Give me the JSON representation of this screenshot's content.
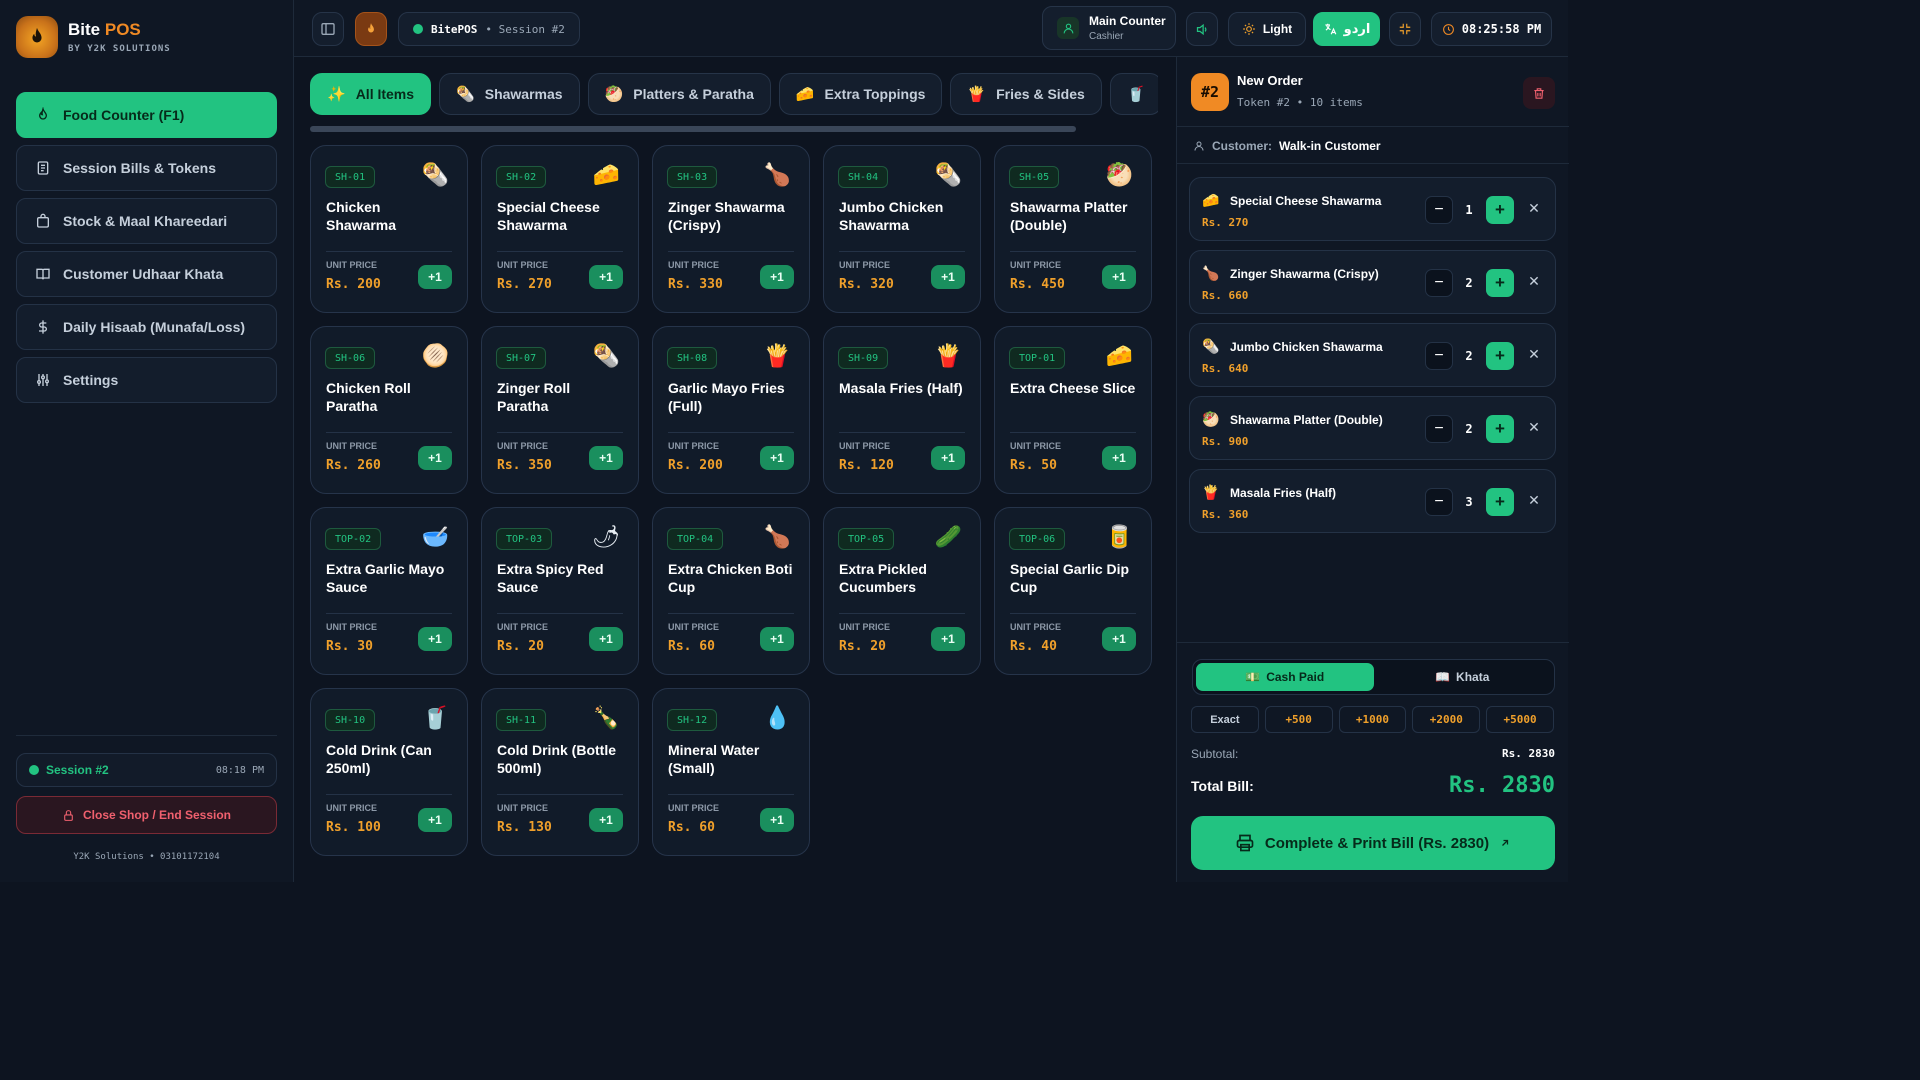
{
  "brand": {
    "name": "Bite",
    "name_accent": "POS",
    "sub": "BY Y2K SOLUTIONS"
  },
  "nav": [
    {
      "label": "Food Counter (F1)",
      "icon": "flame-icon",
      "active": true
    },
    {
      "label": "Session Bills & Tokens",
      "icon": "receipt-icon"
    },
    {
      "label": "Stock & Maal Khareedari",
      "icon": "bag-icon"
    },
    {
      "label": "Customer Udhaar Khata",
      "icon": "book-icon"
    },
    {
      "label": "Daily Hisaab (Munafa/Loss)",
      "icon": "dollar-icon"
    },
    {
      "label": "Settings",
      "icon": "sliders-icon"
    }
  ],
  "sidebar_footer": {
    "session_label": "Session #2",
    "session_time": "08:18 PM",
    "close_label": "Close Shop / End Session",
    "credit": "Y2K Solutions • 03101172104"
  },
  "topbar": {
    "app": "BitePOS",
    "session": "• Session #2",
    "counter_title": "Main Counter",
    "counter_role": "Cashier",
    "theme_label": "Light",
    "language_label": "اردو",
    "clock": "08:25:58 PM"
  },
  "categories": [
    {
      "label": "All Items",
      "icon": "✨",
      "active": true
    },
    {
      "label": "Shawarmas",
      "icon": "🌯"
    },
    {
      "label": "Platters & Paratha",
      "icon": "🥙"
    },
    {
      "label": "Extra Toppings",
      "icon": "🧀"
    },
    {
      "label": "Fries & Sides",
      "icon": "🍟"
    },
    {
      "label": "",
      "icon": "🥤"
    }
  ],
  "card_labels": {
    "unit_price": "UNIT PRICE",
    "add": "+1"
  },
  "products": [
    {
      "code": "SH-01",
      "name": "Chicken Shawarma",
      "price": "Rs. 200",
      "emoji": "🌯"
    },
    {
      "code": "SH-02",
      "name": "Special Cheese Shawarma",
      "price": "Rs. 270",
      "emoji": "🧀"
    },
    {
      "code": "SH-03",
      "name": "Zinger Shawarma (Crispy)",
      "price": "Rs. 330",
      "emoji": "🍗"
    },
    {
      "code": "SH-04",
      "name": "Jumbo Chicken Shawarma",
      "price": "Rs. 320",
      "emoji": "🌯"
    },
    {
      "code": "SH-05",
      "name": "Shawarma Platter (Double)",
      "price": "Rs. 450",
      "emoji": "🥙"
    },
    {
      "code": "SH-06",
      "name": "Chicken Roll Paratha",
      "price": "Rs. 260",
      "emoji": "🫓"
    },
    {
      "code": "SH-07",
      "name": "Zinger Roll Paratha",
      "price": "Rs. 350",
      "emoji": "🌯"
    },
    {
      "code": "SH-08",
      "name": "Garlic Mayo Fries (Full)",
      "price": "Rs. 200",
      "emoji": "🍟"
    },
    {
      "code": "SH-09",
      "name": "Masala Fries (Half)",
      "price": "Rs. 120",
      "emoji": "🍟"
    },
    {
      "code": "TOP-01",
      "name": "Extra Cheese Slice",
      "price": "Rs. 50",
      "emoji": "🧀"
    },
    {
      "code": "TOP-02",
      "name": "Extra Garlic Mayo Sauce",
      "price": "Rs. 30",
      "emoji": "🥣"
    },
    {
      "code": "TOP-03",
      "name": "Extra Spicy Red Sauce",
      "price": "Rs. 20",
      "emoji": "🌶"
    },
    {
      "code": "TOP-04",
      "name": "Extra Chicken Boti Cup",
      "price": "Rs. 60",
      "emoji": "🍗"
    },
    {
      "code": "TOP-05",
      "name": "Extra Pickled Cucumbers",
      "price": "Rs. 20",
      "emoji": "🥒"
    },
    {
      "code": "TOP-06",
      "name": "Special Garlic Dip Cup",
      "price": "Rs. 40",
      "emoji": "🥫"
    },
    {
      "code": "SH-10",
      "name": "Cold Drink (Can 250ml)",
      "price": "Rs. 100",
      "emoji": "🥤"
    },
    {
      "code": "SH-11",
      "name": "Cold Drink (Bottle 500ml)",
      "price": "Rs. 130",
      "emoji": "🍾"
    },
    {
      "code": "SH-12",
      "name": "Mineral Water (Small)",
      "price": "Rs. 60",
      "emoji": "💧"
    }
  ],
  "order": {
    "token": "#2",
    "title": "New Order",
    "sub": "Token #2 • 10 items",
    "customer_key": "Customer:",
    "customer_value": "Walk-in Customer",
    "lines": [
      {
        "name": "Special Cheese Shawarma",
        "price": "Rs. 270",
        "qty": "1",
        "emoji": "🧀"
      },
      {
        "name": "Zinger Shawarma (Crispy)",
        "price": "Rs. 660",
        "qty": "2",
        "emoji": "🍗"
      },
      {
        "name": "Jumbo Chicken Shawarma",
        "price": "Rs. 640",
        "qty": "2",
        "emoji": "🌯"
      },
      {
        "name": "Shawarma Platter (Double)",
        "price": "Rs. 900",
        "qty": "2",
        "emoji": "🥙"
      },
      {
        "name": "Masala Fries (Half)",
        "price": "Rs. 360",
        "qty": "3",
        "emoji": "🍟"
      }
    ],
    "pay_modes": [
      {
        "label": "Cash Paid",
        "icon": "💵",
        "active": true
      },
      {
        "label": "Khata",
        "icon": "📖"
      }
    ],
    "quick_amounts": [
      "Exact",
      "+500",
      "+1000",
      "+2000",
      "+5000"
    ],
    "subtotal_label": "Subtotal:",
    "subtotal_value": "Rs. 2830",
    "total_label": "Total Bill:",
    "total_value": "Rs. 2830",
    "complete_label": "Complete & Print Bill (Rs. 2830)"
  },
  "colors": {
    "accent": "#22c381",
    "orange": "#f08a24",
    "price": "#f0a02b",
    "bg": "#0d1420",
    "danger": "#f0606e"
  }
}
